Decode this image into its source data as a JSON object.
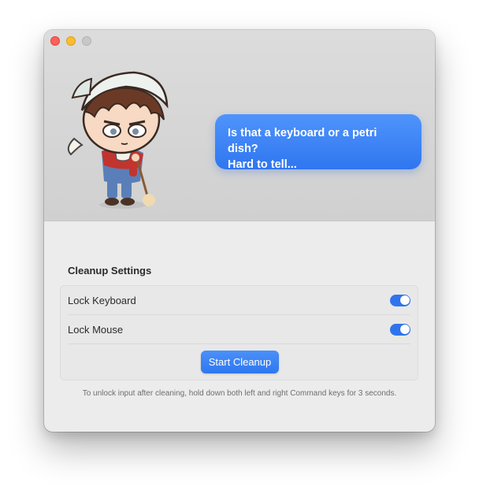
{
  "window": {
    "traffic_lights": [
      "close",
      "minimize",
      "zoom"
    ]
  },
  "hero": {
    "mascot_icon": "chibi-cleaner-character",
    "speech_bubble": {
      "line1": "Is that a keyboard or a petri dish?",
      "line2": "Hard to tell..."
    }
  },
  "settings": {
    "title": "Cleanup Settings",
    "lock_keyboard": {
      "label": "Lock Keyboard",
      "enabled": true
    },
    "lock_mouse": {
      "label": "Lock Mouse",
      "enabled": true
    },
    "start_button": "Start Cleanup"
  },
  "hint": "To unlock input after cleaning, hold down both left and right Command keys for 3 seconds.",
  "colors": {
    "accent": "#2f76f0",
    "close": "#fe5f57",
    "minimize": "#febc2e",
    "zoom_disabled": "#c8c8c8"
  }
}
